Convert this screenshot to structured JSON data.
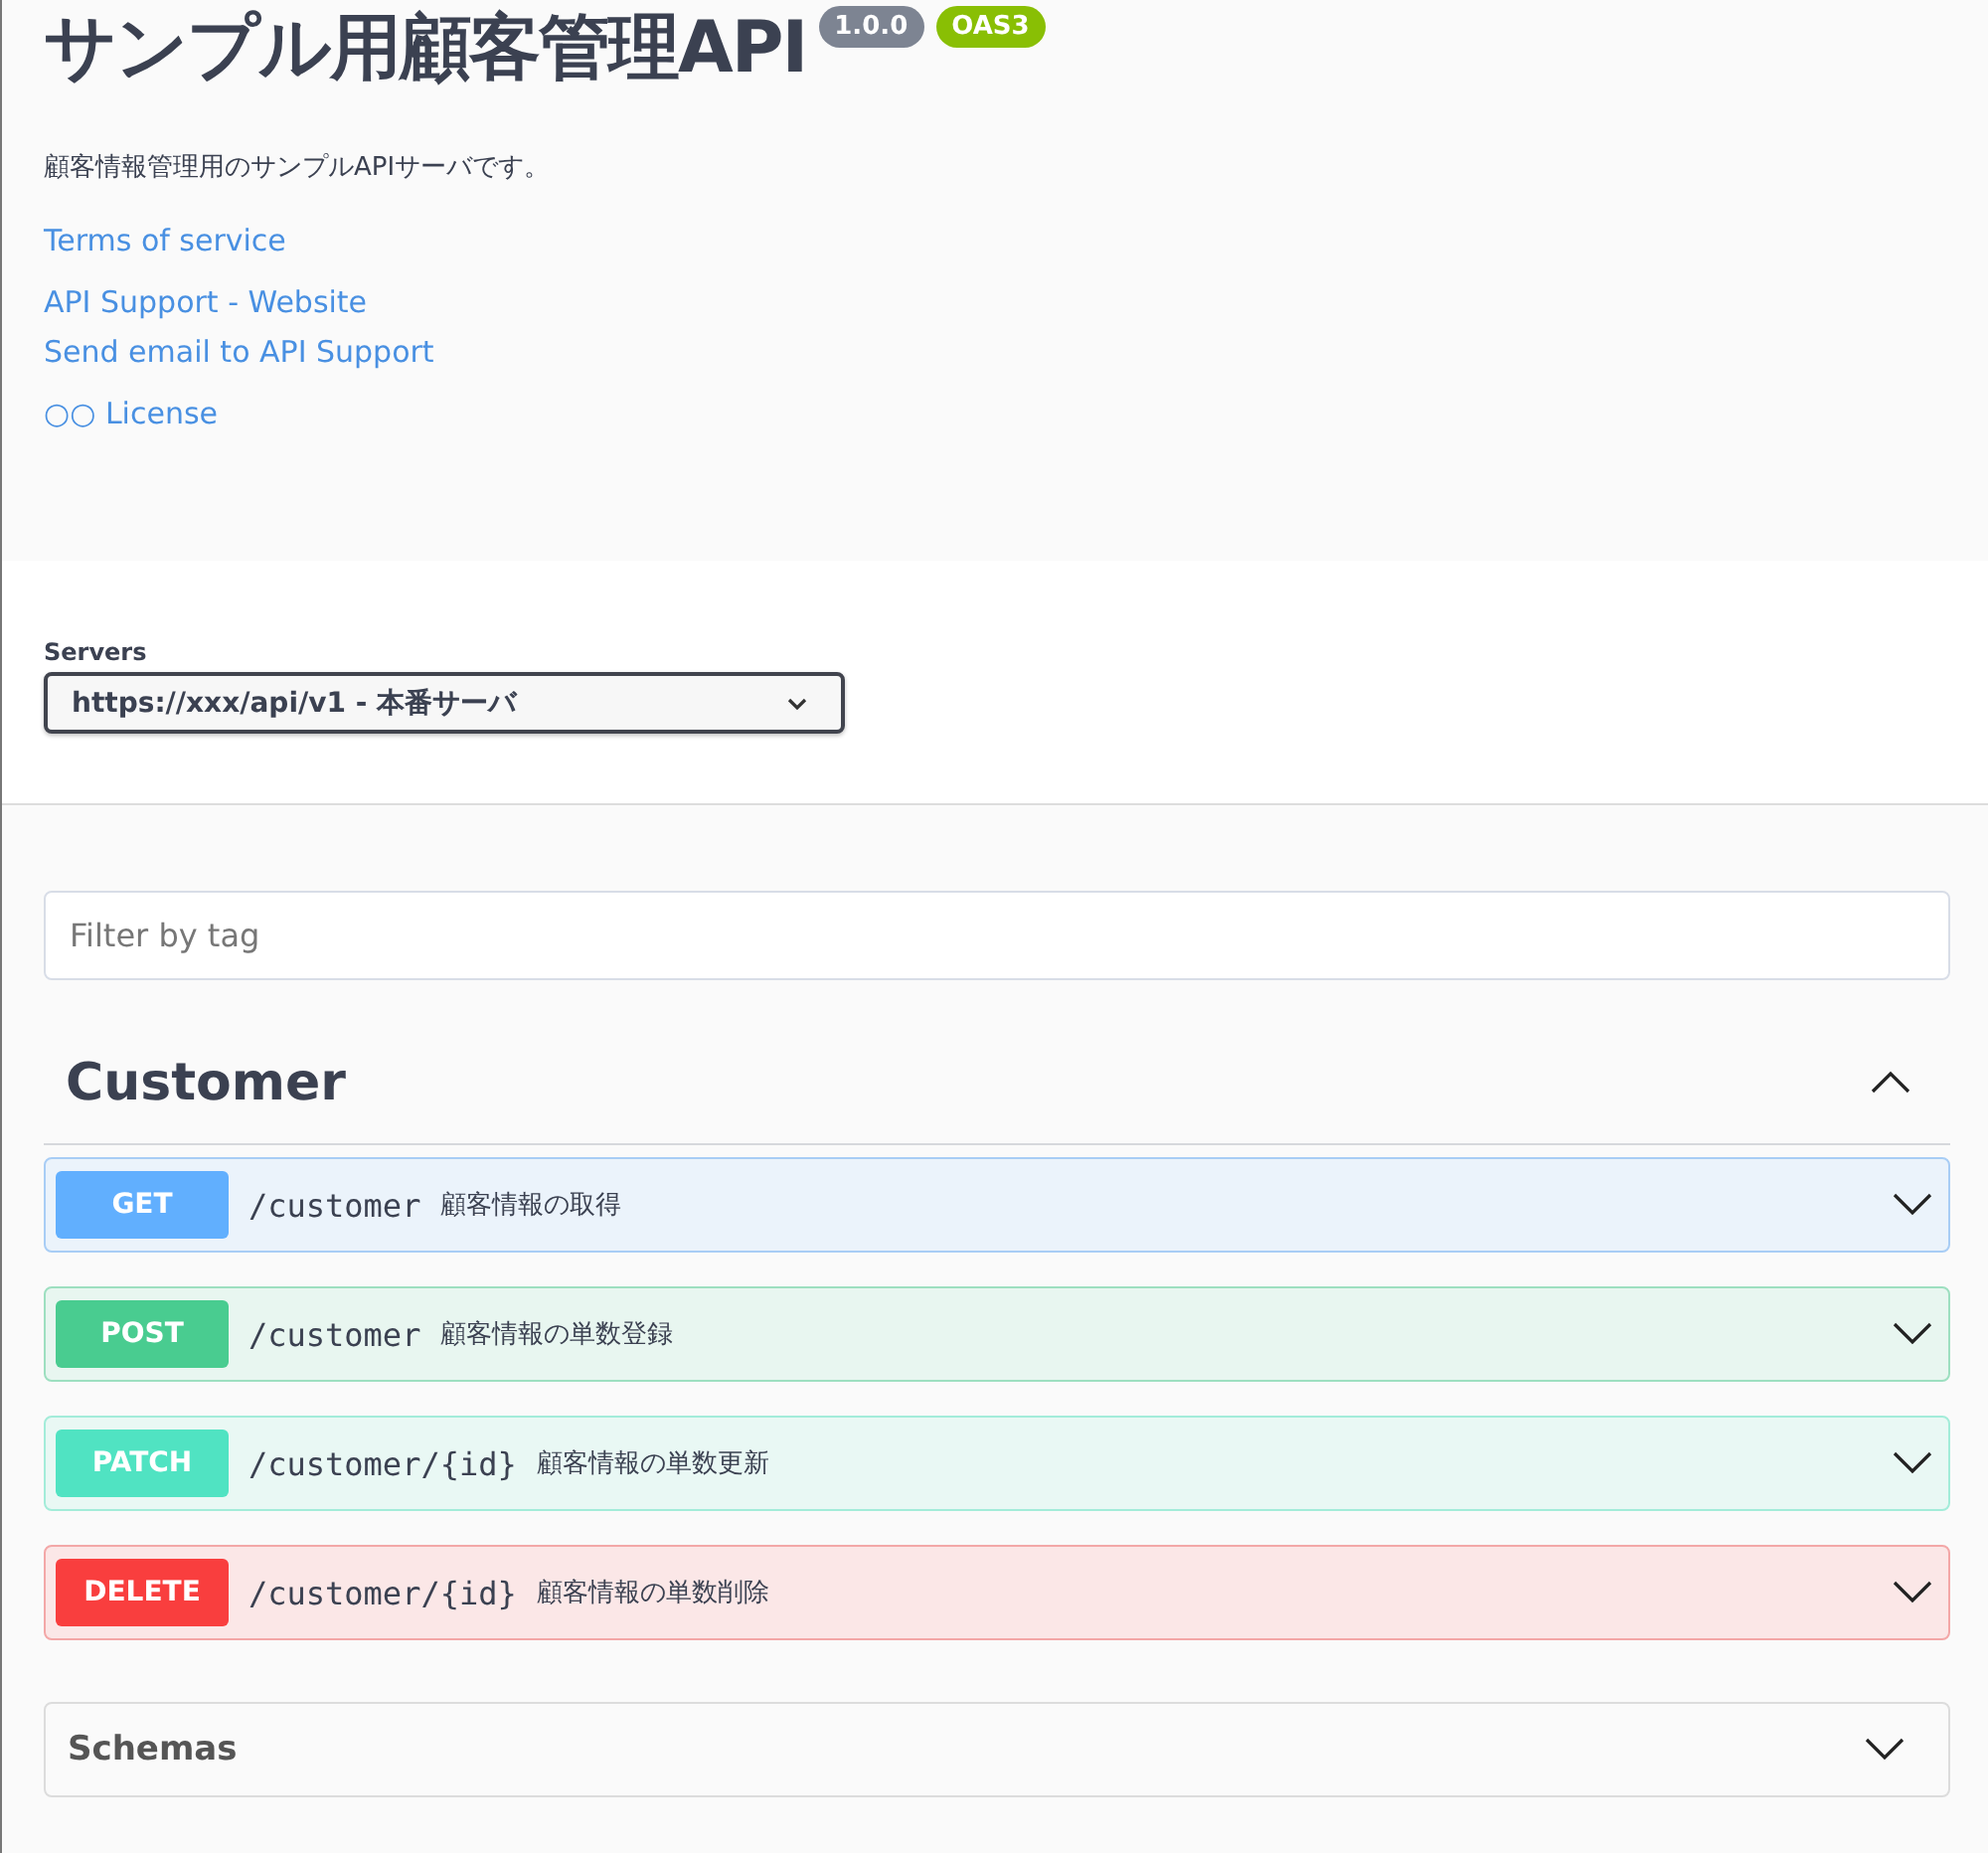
{
  "info": {
    "title": "サンプル用顧客管理API",
    "version": "1.0.0",
    "spec_badge": "OAS3",
    "description": "顧客情報管理用のサンプルAPIサーバです。",
    "links": [
      {
        "label": "Terms of service"
      },
      {
        "label": "API Support - Website"
      },
      {
        "label": "Send email to API Support"
      },
      {
        "label": "○○ License"
      }
    ]
  },
  "servers": {
    "label": "Servers",
    "value": "https://xxx/api/v1 - 本番サーバ"
  },
  "filter": {
    "placeholder": "Filter by tag"
  },
  "tags": [
    {
      "name": "Customer",
      "expanded": true,
      "operations": [
        {
          "method": "GET",
          "path": "/customer",
          "summary": "顧客情報の取得",
          "expanded": false
        },
        {
          "method": "POST",
          "path": "/customer",
          "summary": "顧客情報の単数登録",
          "expanded": false
        },
        {
          "method": "PATCH",
          "path": "/customer/{id}",
          "summary": "顧客情報の単数更新",
          "expanded": false
        },
        {
          "method": "DELETE",
          "path": "/customer/{id}",
          "summary": "顧客情報の単数削除",
          "expanded": false
        }
      ]
    }
  ],
  "schemas": {
    "title": "Schemas",
    "expanded": false
  }
}
